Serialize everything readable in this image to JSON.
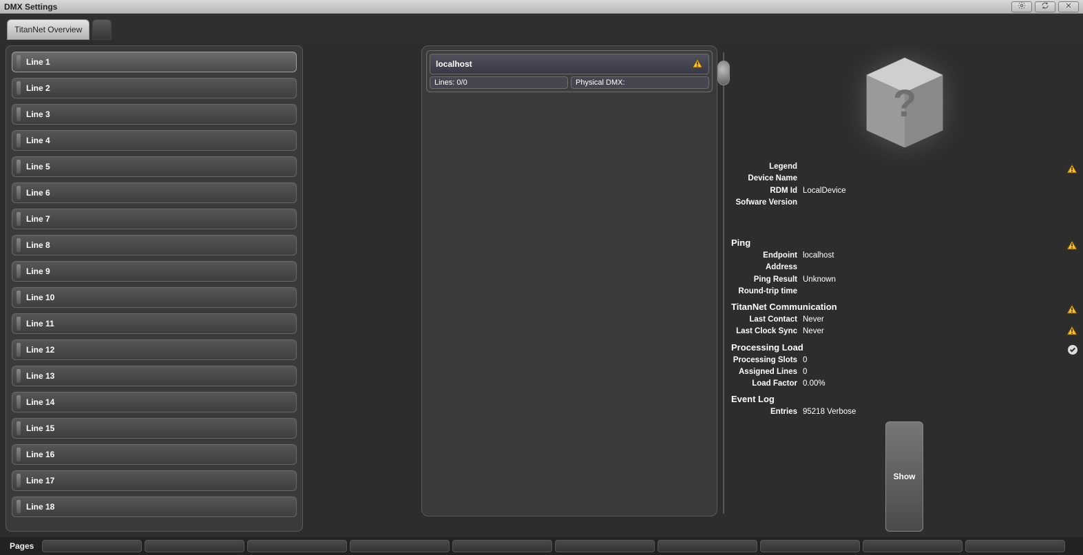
{
  "window": {
    "title": "DMX Settings"
  },
  "tabs": {
    "active_label": "TitanNet Overview"
  },
  "lines": [
    "Line 1",
    "Line 2",
    "Line 3",
    "Line 4",
    "Line 5",
    "Line 6",
    "Line 7",
    "Line 8",
    "Line 9",
    "Line 10",
    "Line 11",
    "Line 12",
    "Line 13",
    "Line 14",
    "Line 15",
    "Line 16",
    "Line 17",
    "Line 18"
  ],
  "selected_line_index": 0,
  "node": {
    "host": "localhost",
    "lines_label": "Lines: 0/0",
    "physical_label": "Physical DMX:"
  },
  "device_info": {
    "legend_label": "Legend",
    "legend_value": "",
    "devname_label": "Device Name",
    "devname_value": "",
    "rdm_label": "RDM Id",
    "rdm_value": "LocalDevice",
    "ver_label": "Sofware Version",
    "ver_value": ""
  },
  "ping": {
    "heading": "Ping",
    "endpoint_label": "Endpoint Address",
    "endpoint_value": "localhost",
    "result_label": "Ping Result",
    "result_value": "Unknown",
    "rtt_label": "Round-trip time",
    "rtt_value": ""
  },
  "comm": {
    "heading": "TitanNet Communication",
    "lastcontact_label": "Last Contact",
    "lastcontact_value": "Never",
    "lastclock_label": "Last Clock Sync",
    "lastclock_value": "Never"
  },
  "load": {
    "heading": "Processing Load",
    "slots_label": "Processing Slots",
    "slots_value": "0",
    "assigned_label": "Assigned Lines",
    "assigned_value": "0",
    "factor_label": "Load Factor",
    "factor_value": "0.00%"
  },
  "eventlog": {
    "heading": "Event Log",
    "entries_label": "Entries",
    "entries_value": "95218 Verbose",
    "show_label": "Show"
  },
  "footer": {
    "pages_label": "Pages",
    "slot_count": 10
  }
}
